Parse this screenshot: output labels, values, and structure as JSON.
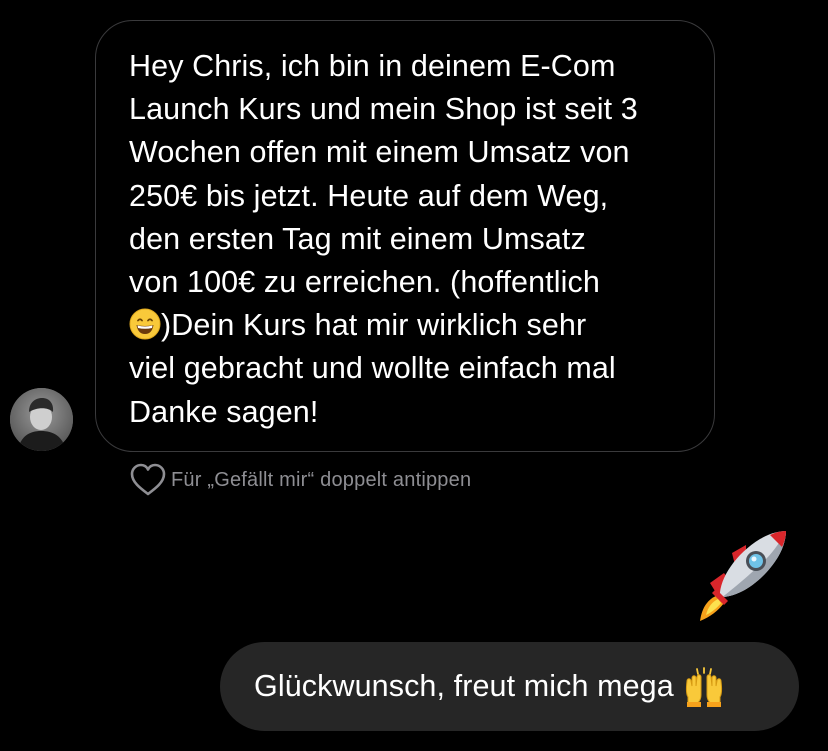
{
  "incoming_message": {
    "text_before_emoji": "Hey Chris, ich bin in deinem E-Com\nLaunch Kurs und mein Shop ist seit 3\nWochen offen mit einem Umsatz von\n250€ bis jetzt. Heute auf dem Weg,\nden ersten Tag mit einem Umsatz\nvon 100€ zu erreichen. (hoffentlich\n",
    "emoji": "grinning-face-emoji",
    "text_after_emoji": ")Dein Kurs hat mir wirklich sehr\nviel gebracht und wollte einfach mal\nDanke sagen!"
  },
  "like_hint": "Für „Gefällt mir“ doppelt antippen",
  "reaction_sticker": "rocket-emoji",
  "outgoing_message": {
    "text": "Glückwunsch, freut mich mega",
    "emoji": "raising-hands-emoji"
  },
  "colors": {
    "background": "#000000",
    "incoming_bubble_border": "#3a3a3c",
    "outgoing_bubble": "#262626",
    "hint_text": "#8e8e93"
  }
}
